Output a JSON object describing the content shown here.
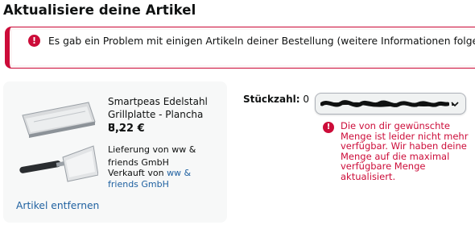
{
  "page": {
    "title": "Aktualisiere deine Artikel"
  },
  "alert": {
    "icon": "exclamation-icon",
    "color": "#cc0c39",
    "message": "Es gab ein Problem mit einigen Artikeln deiner Bestellung (weitere Informationen folgen):"
  },
  "item": {
    "image": "spatula-grill-plate-image",
    "title": "Smartpeas Edelstahl Grillplatte - Plancha U…",
    "price": "8,22 €",
    "delivery": "Lieferung von ww & friends GmbH",
    "seller_prefix": "Verkauft von",
    "seller_name": "ww & friends GmbH",
    "remove_label": "Artikel entfernen"
  },
  "quantity": {
    "label": "Stückzahl:",
    "value": "0",
    "selected_option": ".",
    "dropdown_icon": "chevron-down-icon"
  },
  "error": {
    "icon": "exclamation-icon",
    "color": "#cc0c39",
    "message": "Die von dir gewünschte Menge ist leider nicht mehr verfügbar. Wir haben deine Menge auf die maximal verfügbare Menge aktualisiert."
  },
  "colors": {
    "link": "#2162a1",
    "error": "#cc0c39",
    "card_bg": "#f7f8f8"
  }
}
